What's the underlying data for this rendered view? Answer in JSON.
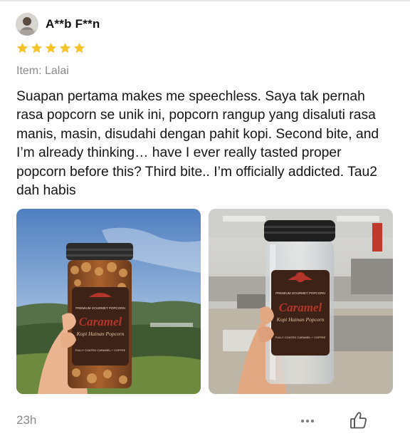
{
  "review": {
    "username": "A**b F**n",
    "rating": 5,
    "item_label": "Item: Lalai",
    "text": "Suapan pertama makes me speechless. Saya tak pernah rasa popcorn se unik ini, popcorn rangup yang disaluti rasa manis, masin, disudahi dengan pahit kopi. Second bite, and I’m already thinking… have I ever really tasted proper popcorn before this? Third bite.. I’m officially addicted. Tau2 dah habis",
    "timestamp": "23h"
  },
  "photos": [
    {
      "label_title": "Caramel",
      "label_subtitle": "Kopi Hainan Popcorn",
      "label_brand": "PREMIUM GOURMET POPCORN",
      "label_tag": "FULLY COATED CARAMEL + COFFEE"
    },
    {
      "label_title": "Caramel",
      "label_subtitle": "Kopi Hainan Popcorn",
      "label_brand": "PREMIUM GOURMET POPCORN",
      "label_tag": "FULLY COATED CARAMEL + COFFEE"
    }
  ],
  "icons": {
    "star": "star-icon",
    "more": "more-options-icon",
    "like": "thumbs-up-icon"
  },
  "colors": {
    "star": "#f7c52b",
    "muted_text": "#8a8a8a",
    "label_red": "#b5352a",
    "label_brown": "#3d2218"
  }
}
